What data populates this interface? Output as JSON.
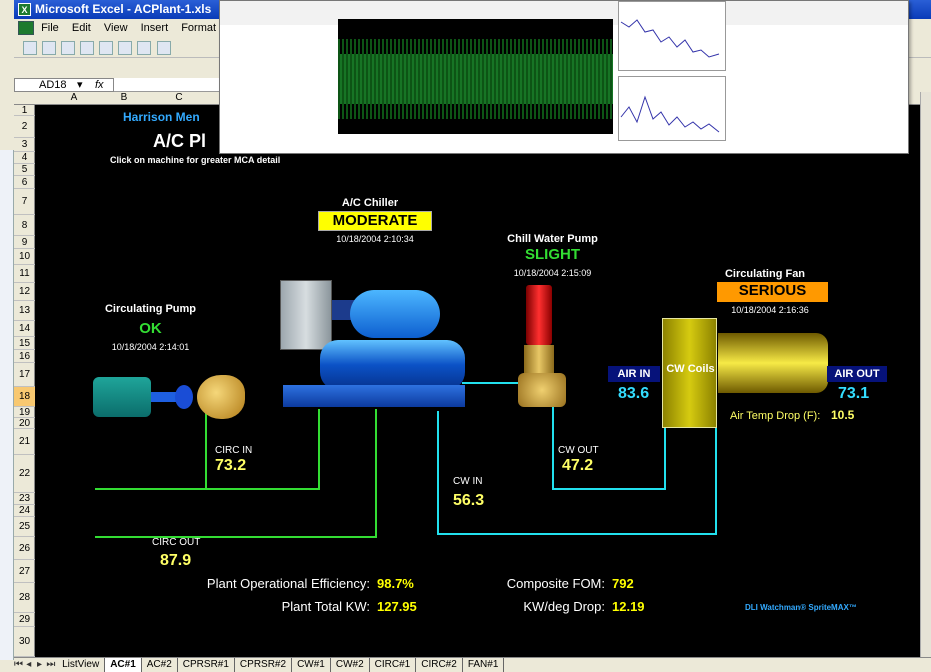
{
  "window": {
    "title": "Microsoft Excel - ACPlant-1.xls",
    "app_icon": "excel-icon"
  },
  "menu": [
    "File",
    "Edit",
    "View",
    "Insert",
    "Format"
  ],
  "namebox": {
    "value": "AD18",
    "fx": "fx"
  },
  "columns": [
    "A",
    "B",
    "C"
  ],
  "rows": [
    "1",
    "2",
    "3",
    "4",
    "5",
    "6",
    "7",
    "8",
    "9",
    "10",
    "11",
    "12",
    "13",
    "14",
    "15",
    "16",
    "17",
    "18",
    "19",
    "20",
    "21",
    "22",
    "23",
    "24",
    "25",
    "26",
    "27",
    "28",
    "29",
    "30"
  ],
  "selected_row": "18",
  "sheet": {
    "header_line": "Harrison Men",
    "title": "A/C Pl",
    "hint": "Click on machine for greater MCA detail",
    "chiller": {
      "label": "A/C Chiller",
      "status": "MODERATE",
      "status_bg": "#ffff00",
      "status_fg": "#000000",
      "timestamp": "10/18/2004 2:10:34"
    },
    "chill_pump": {
      "label": "Chill Water Pump",
      "status": "SLIGHT",
      "status_fg": "#33dd33",
      "timestamp": "10/18/2004 2:15:09"
    },
    "fan": {
      "label": "Circulating Fan",
      "status": "SERIOUS",
      "status_bg": "#ff9900",
      "status_fg": "#000000",
      "timestamp": "10/18/2004 2:16:36"
    },
    "circ_pump": {
      "label": "Circulating Pump",
      "status": "OK",
      "status_fg": "#33dd33",
      "timestamp": "10/18/2004 2:14:01"
    },
    "circ_in": {
      "label": "CIRC IN",
      "value": "73.2"
    },
    "circ_out": {
      "label": "CIRC OUT",
      "value": "87.9"
    },
    "cw_in": {
      "label": "CW IN",
      "value": "56.3"
    },
    "cw_out": {
      "label": "CW OUT",
      "value": "47.2"
    },
    "air_in": {
      "label": "AIR IN",
      "value": "83.6"
    },
    "air_out": {
      "label": "AIR OUT",
      "value": "73.1"
    },
    "cw_coils": "CW Coils",
    "air_temp_drop": {
      "label": "Air Temp Drop (F):",
      "value": "10.5"
    },
    "stats": {
      "efficiency_label": "Plant Operational Efficiency:",
      "efficiency_value": "98.7%",
      "kw_label": "Plant Total KW:",
      "kw_value": "127.95",
      "fom_label": "Composite FOM:",
      "fom_value": "792",
      "kwdeg_label": "KW/deg Drop:",
      "kwdeg_value": "12.19"
    },
    "brand": "DLI Watchman® SpriteMAX™"
  },
  "tabs": [
    "ListView",
    "AC#1",
    "AC#2",
    "CPRSR#1",
    "CPRSR#2",
    "CW#1",
    "CW#2",
    "CIRC#1",
    "CIRC#2",
    "FAN#1"
  ],
  "active_tab": "AC#1"
}
